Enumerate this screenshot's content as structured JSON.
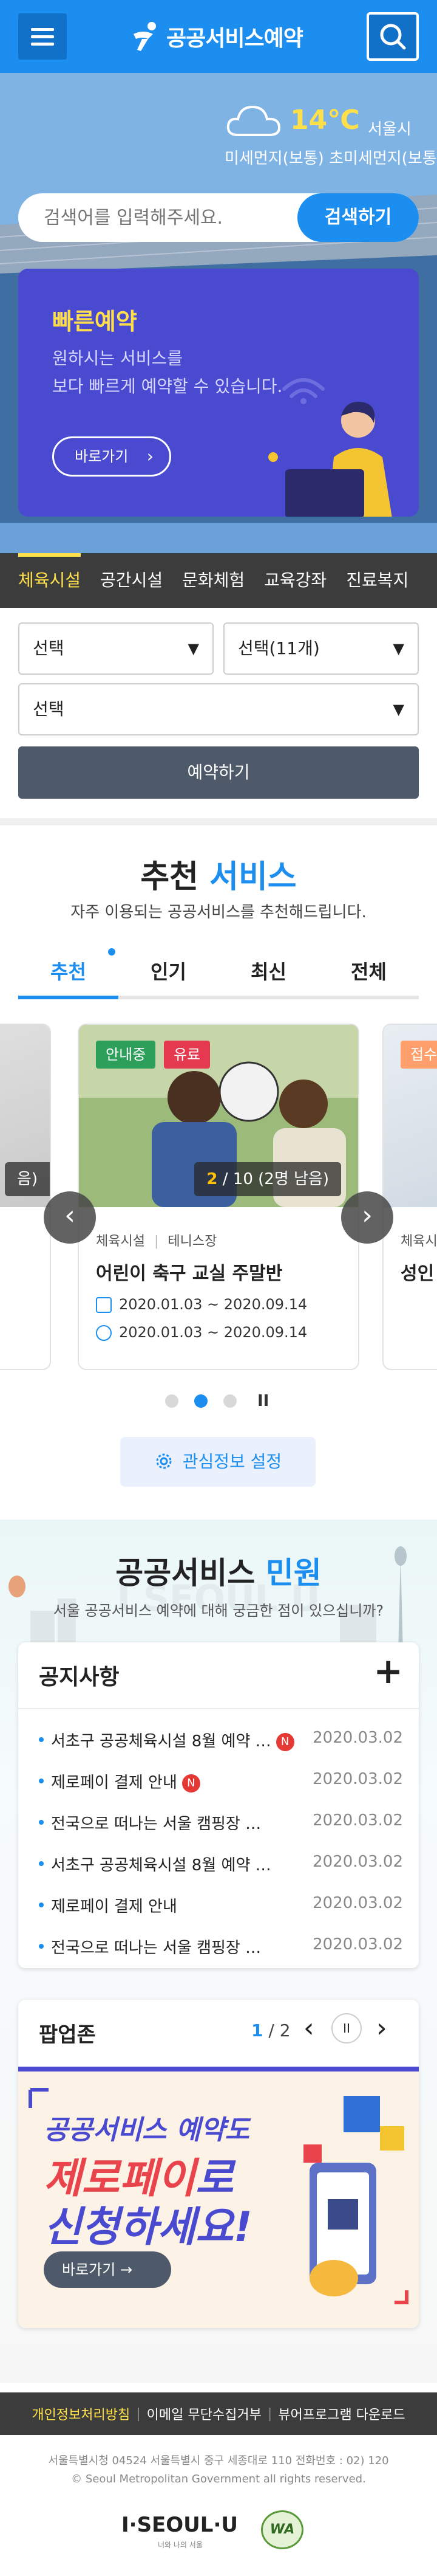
{
  "header": {
    "logo_text": "공공서비스예약"
  },
  "weather": {
    "temperature": "14℃",
    "city": "서울시",
    "dust": "미세먼지(보통) 초미세먼지(보통)"
  },
  "search": {
    "placeholder": "검색어를 입력해주세요.",
    "button": "검색하기"
  },
  "quick": {
    "title": "빠른예약",
    "desc_line1": "원하시는 서비스를",
    "desc_line2": "보다 빠르게 예약할 수 있습니다.",
    "button": "바로가기"
  },
  "categories": [
    "체육시설",
    "공간시설",
    "문화체험",
    "교육강좌",
    "진료복지"
  ],
  "form": {
    "select1": "선택",
    "select2": "선택(11개)",
    "select3": "선택",
    "reserve_button": "예약하기"
  },
  "recommend": {
    "title_main": "추천",
    "title_accent": "서비스",
    "subtitle": "자주 이용되는 공공서비스를 추천해드립니다.",
    "tabs": [
      "추천",
      "인기",
      "최신",
      "전체"
    ],
    "card": {
      "badge_status": "안내중",
      "badge_fee": "유료",
      "count_prefix": "2",
      "count_rest": " / 10 (2명 남음)",
      "category": "체육시설",
      "subcategory": "테니스장",
      "title": "어린이 축구 교실 주말반",
      "date1": "2020.01.03 ~ 2020.09.14",
      "date2": "2020.01.03 ~ 2020.09.14"
    },
    "side_left_tag": "음)",
    "side_right_badge": "접수",
    "side_right_cat": "체육시",
    "side_right_title": "성인",
    "interest_button": "관심정보 설정",
    "pause_glyph": "II"
  },
  "minwon": {
    "title_main": "공공서비스",
    "title_accent": "민원",
    "subtitle": "서울 공공서비스 예약에 대해 궁금한 점이 있으십니까?",
    "bg_text": "I SEOUL U"
  },
  "notice": {
    "title": "공지사항",
    "items": [
      {
        "text": "서초구 공공체육시설 8월 예약 …",
        "new": "N",
        "date": "2020.03.02"
      },
      {
        "text": "제로페이 결제 안내",
        "new": "N",
        "date": "2020.03.02"
      },
      {
        "text": "전국으로 떠나는 서울 캠핑장 …",
        "new": "",
        "date": "2020.03.02"
      },
      {
        "text": "서초구 공공체육시설 8월 예약 …",
        "new": "",
        "date": "2020.03.02"
      },
      {
        "text": "제로페이 결제 안내",
        "new": "",
        "date": "2020.03.02"
      },
      {
        "text": "전국으로 떠나는 서울 캠핑장 …",
        "new": "",
        "date": "2020.03.02"
      }
    ]
  },
  "popup": {
    "title": "팝업존",
    "page_current": "1",
    "page_total": "/ 2",
    "banner_line1": "공공서비스 예약도",
    "banner_line2_accent": "제로페이",
    "banner_line2_rest": "로",
    "banner_line3": "신청하세요!",
    "banner_button": "바로가기 →"
  },
  "footer": {
    "link1": "개인정보처리방침",
    "link2": "이메일 무단수집거부",
    "link3": "뷰어프로그램 다운로드",
    "address": "서울특별시청 04524 서울특별시 중구 세종대로 110 전화번호 : 02) 120",
    "copyright": "© Seoul Metropolitan Government all rights reserved.",
    "logo_text": "I·SEOUL·U",
    "logo_sub": "너와 나의 서울",
    "wa_text": "WA"
  }
}
